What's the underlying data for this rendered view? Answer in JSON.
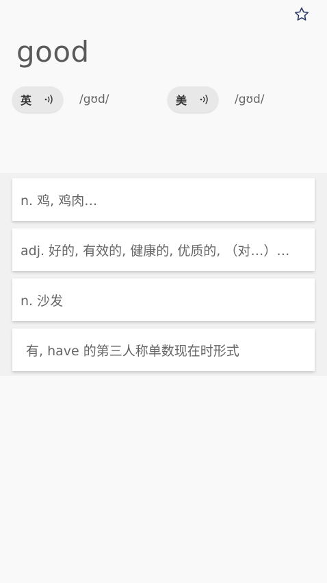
{
  "header": {
    "word": "good",
    "favorite_icon": "star-outline-icon"
  },
  "pronunciations": [
    {
      "lang": "英",
      "phonetic": "/gʊd/",
      "icon": "speaker-icon"
    },
    {
      "lang": "美",
      "phonetic": "/gʊd/",
      "icon": "speaker-icon"
    }
  ],
  "definitions": [
    "n. 鸡, 鸡肉…",
    "adj. 好的, 有效的, 健康的, 优质的, （对…）…",
    "n. 沙发",
    "有, have 的第三人称单数现在时形式"
  ],
  "colors": {
    "background": "#f9f9f9",
    "card": "#ffffff",
    "pill": "#e8e8e8",
    "star": "#2b3a67"
  }
}
